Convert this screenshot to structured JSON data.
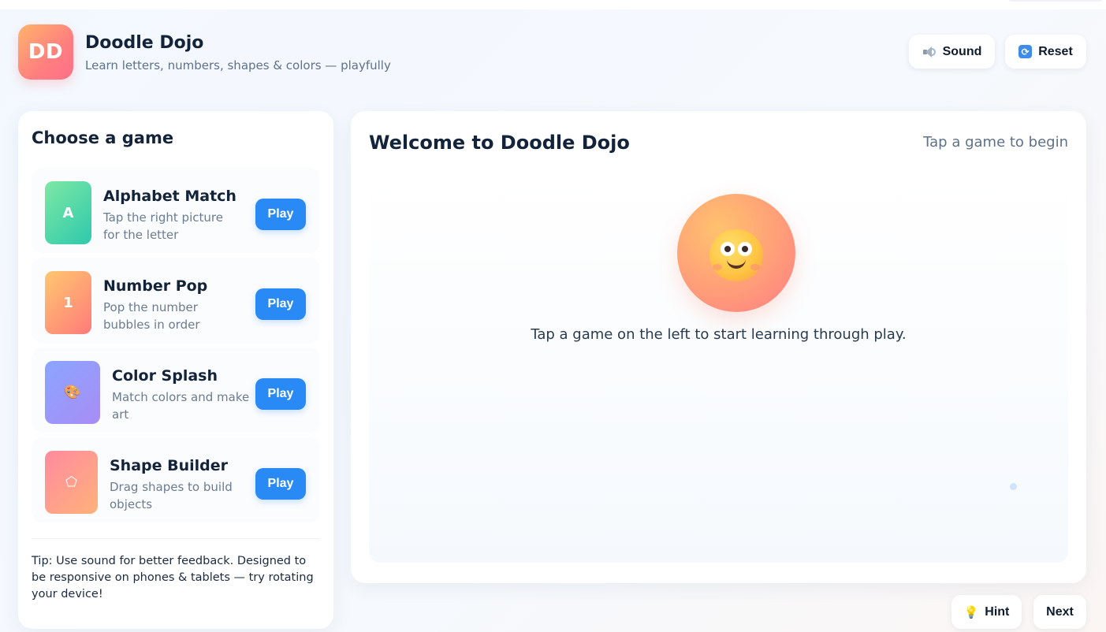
{
  "app": {
    "logo_text": "DD",
    "title": "Doodle Dojo",
    "subtitle": "Learn letters, numbers, shapes & colors — playfully"
  },
  "header_buttons": {
    "sound_label": "Sound",
    "sound_icon": "speaker-icon",
    "reset_label": "Reset",
    "reset_icon": "repeat-icon"
  },
  "sidebar": {
    "title": "Choose a game",
    "games": [
      {
        "name": "Alphabet Match",
        "description": "Tap the right picture for the letter",
        "icon_text": "A",
        "icon_color_from": "#7ee8a4",
        "icon_color_to": "#2ec9ad",
        "play_label": "Play"
      },
      {
        "name": "Number Pop",
        "description": "Pop the number bubbles in order",
        "icon_text": "1",
        "icon_color_from": "#ffc870",
        "icon_color_to": "#ff7a7a",
        "play_label": "Play"
      },
      {
        "name": "Color Splash",
        "description": "Match colors and make art",
        "icon_text": "🎨",
        "icon_color_from": "#8aa6ff",
        "icon_color_to": "#a98cf5",
        "play_label": "Play"
      },
      {
        "name": "Shape Builder",
        "description": "Drag shapes to build objects",
        "icon_text": "⬠",
        "icon_color_from": "#ff8aa0",
        "icon_color_to": "#ffb27a",
        "play_label": "Play"
      }
    ],
    "tip": "Tip: Use sound for better feedback. Designed to be responsive on phones & tablets — try rotating your device!"
  },
  "main": {
    "title": "Welcome to Doodle Dojo",
    "hint": "Tap a game to begin",
    "message": "Tap a game on the left to start learning through play.",
    "mascot_icon": "smiling-face-icon"
  },
  "footer_buttons": {
    "hint_label": "Hint",
    "hint_icon": "lightbulb-icon",
    "next_label": "Next"
  },
  "colors": {
    "accent": "#2a8af5",
    "text_primary": "#13233a",
    "text_secondary": "#5f7189"
  }
}
